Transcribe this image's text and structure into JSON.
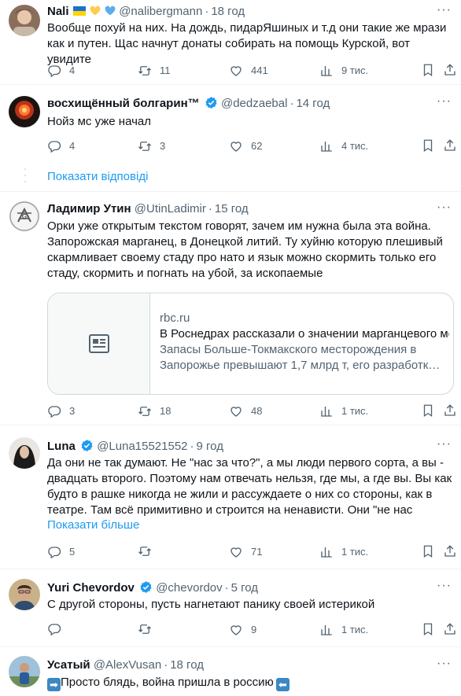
{
  "tweets": [
    {
      "name": "Nali",
      "handle": "@nalibergmann",
      "time": "18 год",
      "text": "Вообще похуй на них. На дождь, пидарЯшиных и т.д они такие же мрази как и путен. Щас начнут донаты собирать на помощь Курской, вот увидите",
      "replies": "4",
      "retweets": "11",
      "likes": "441",
      "views": "9 тис."
    },
    {
      "name": "восхищённый болгарин™",
      "handle": "@dedzaebal",
      "time": "14 год",
      "text": "Нойз  мс уже начал",
      "replies": "4",
      "retweets": "3",
      "likes": "62",
      "views": "4 тис."
    },
    {
      "name": "Ладимир Утин",
      "handle": "@UtinLadimir",
      "time": "15 год",
      "text": "Орки уже открытым текстом говорят, зачем им нужна была эта война. Запорожская марганец, в Донецкой литий. Ту хуйню которую плешивый скармливает своему стаду про нато и язык можно скормить только его стаду, скормить и погнать на убой, за ископаемые",
      "replies": "3",
      "retweets": "18",
      "likes": "48",
      "views": "1 тис.",
      "card": {
        "domain": "rbc.ru",
        "title": "В Роснедрах рассказали о значении марганцевого месторождения",
        "desc": "Запасы Больше-Токмакского месторождения в Запорожье превышают 1,7 млрд т, его разработк…"
      }
    },
    {
      "name": "Luna",
      "handle": "@Luna15521552",
      "time": "9 год",
      "text": "Да они не так думают. Не \"нас за что?\", а мы люди первого сорта, а вы - двадцать второго. Поэтому нам отвечать нельзя, где мы, а где вы.  Вы как будто в рашке никогда не жили и рассуждаете о них со стороны, как в театре.  Там всё примитивно и строится на ненависти.  Они \"не нас",
      "show_more": "Показати більше",
      "replies": "5",
      "retweets": "",
      "likes": "71",
      "views": "1 тис."
    },
    {
      "name": "Yuri Chevordov",
      "handle": "@chevordov",
      "time": "5 год",
      "text": "С другой стороны, пусть нагнетают панику своей истерикой",
      "replies": "",
      "retweets": "",
      "likes": "9",
      "views": "1 тис."
    },
    {
      "name": "Усатый",
      "handle": "@AlexVusan",
      "time": "18 год",
      "text": "Просто блядь, война пришла в россию"
    }
  ],
  "show_replies": "Показати відповіді",
  "icons": {
    "reply": "reply-icon",
    "retweet": "retweet-icon",
    "like": "heart-icon",
    "views": "views-icon",
    "bookmark": "bookmark-icon",
    "share": "share-icon",
    "more": "more-icon",
    "verified": "verified-badge-icon",
    "article": "article-icon"
  },
  "colors": {
    "link": "#1d9bf0",
    "secondary": "#536471",
    "verified": "#1d9bf0"
  }
}
